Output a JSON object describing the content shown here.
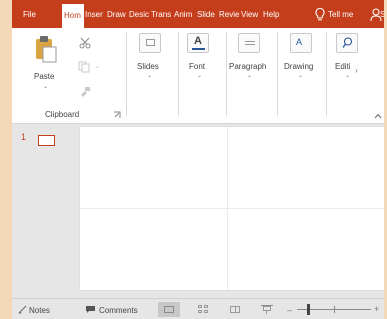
{
  "tabs": [
    {
      "label": "File",
      "active": false
    },
    {
      "label": "Hom",
      "active": true
    },
    {
      "label": "Inser",
      "active": false
    },
    {
      "label": "Draw",
      "active": false
    },
    {
      "label": "Desic",
      "active": false
    },
    {
      "label": "Trans",
      "active": false
    },
    {
      "label": "Anim",
      "active": false
    },
    {
      "label": "Slide",
      "active": false
    },
    {
      "label": "Revie",
      "active": false
    },
    {
      "label": "View",
      "active": false
    },
    {
      "label": "Help",
      "active": false
    }
  ],
  "tell_me": {
    "label": "Tell me",
    "icon": "lightbulb-icon"
  },
  "share": {
    "label": "Sh",
    "icon": "person-icon"
  },
  "ribbon": {
    "paste": {
      "label": "Paste",
      "icon": "clipboard-paste-icon"
    },
    "cut_icon": "scissors-icon",
    "copy_icon": "copy-icon",
    "format_painter_icon": "format-painter-icon",
    "clipboard_group": "Clipboard",
    "slides": {
      "label": "Slides",
      "icon": "slides-icon"
    },
    "font": {
      "label": "Font",
      "icon": "font-a-icon"
    },
    "paragraph": {
      "label": "Paragraph",
      "icon": "paragraph-icon"
    },
    "drawing": {
      "label": "Drawing",
      "icon": "shapes-icon"
    },
    "editing": {
      "label": "Editi",
      "icon": "search-icon"
    }
  },
  "slide_panel": {
    "number": "1"
  },
  "status": {
    "notes": "Notes",
    "comments": "Comments"
  },
  "colors": {
    "accent": "#c43e1c",
    "ribbon_bg": "#ffffff",
    "workspace_bg": "#e6e6e6"
  }
}
